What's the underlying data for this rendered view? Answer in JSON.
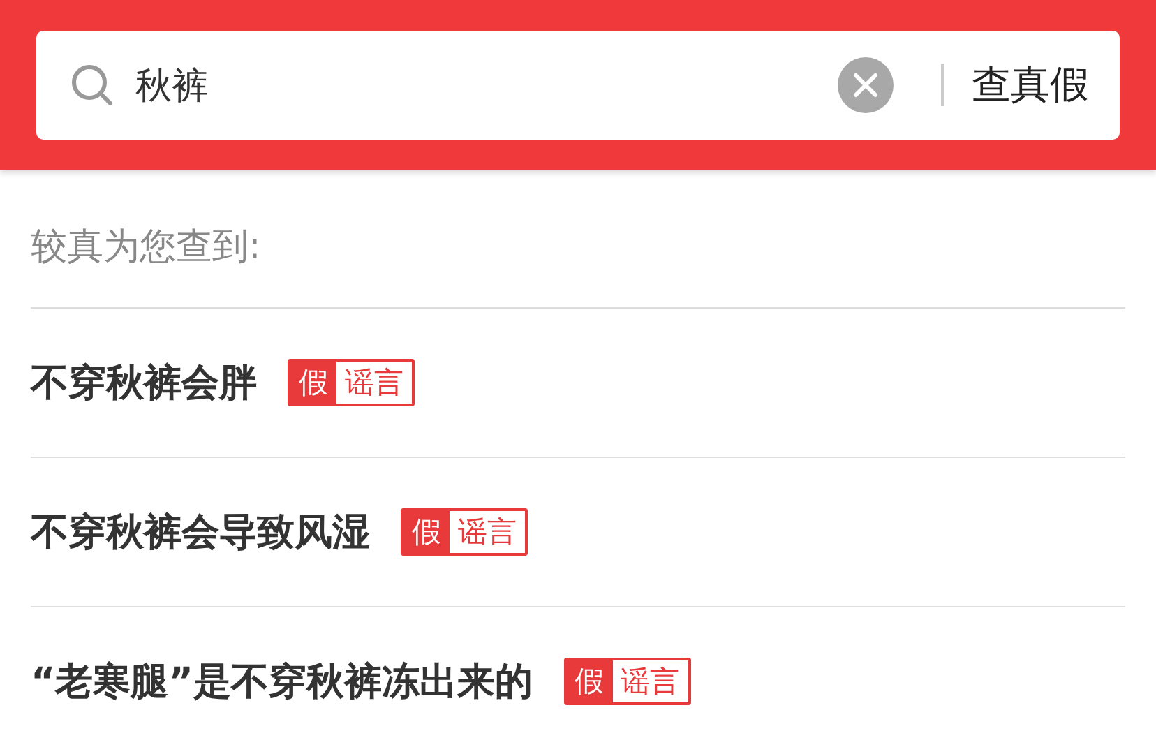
{
  "search": {
    "value": "秋裤",
    "button": "查真假"
  },
  "heading": "较真为您查到:",
  "results": [
    {
      "title": "不穿秋裤会胖",
      "verdict": "假",
      "tag": "谣言"
    },
    {
      "title": "不穿秋裤会导致风湿",
      "verdict": "假",
      "tag": "谣言"
    },
    {
      "title": "“老寒腿”是不穿秋裤冻出来的",
      "verdict": "假",
      "tag": "谣言"
    }
  ]
}
